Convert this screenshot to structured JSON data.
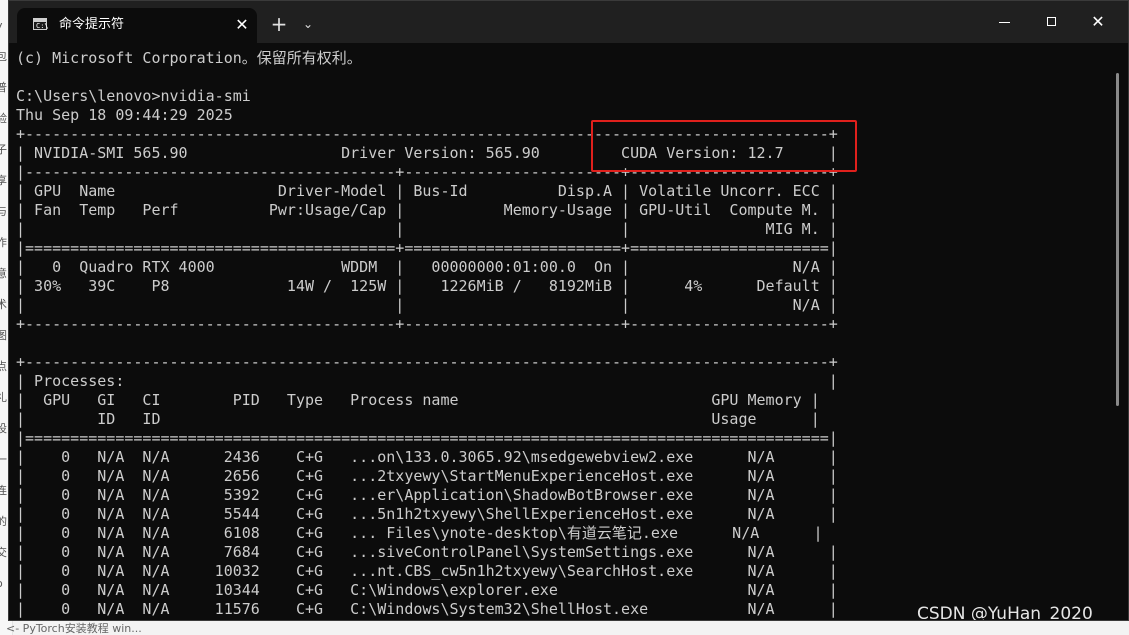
{
  "background_page": {
    "left_fragments": [
      "y",
      "包",
      "普",
      "验",
      "子",
      "享",
      "与",
      "作",
      "意",
      "术",
      "图",
      "点",
      "礼",
      "设",
      "一",
      "连",
      "的",
      "交",
      "o"
    ],
    "bottom_text": "<- PyTorch安装教程 win..."
  },
  "window": {
    "tab_title": "命令提示符",
    "tab_close": "✕",
    "new_tab": "+",
    "dropdown": "⌄",
    "close": "✕"
  },
  "terminal": {
    "lines": [
      "(c) Microsoft Corporation。保留所有权利。",
      "",
      "C:\\Users\\lenovo>nvidia-smi",
      "Thu Sep 18 09:44:29 2025",
      "+-----------------------------------------------------------------------------------------+",
      "| NVIDIA-SMI 565.90                 Driver Version: 565.90         CUDA Version: 12.7     |",
      "|-----------------------------------------+------------------------+----------------------+",
      "| GPU  Name                  Driver-Model | Bus-Id          Disp.A | Volatile Uncorr. ECC |",
      "| Fan  Temp   Perf          Pwr:Usage/Cap |           Memory-Usage | GPU-Util  Compute M. |",
      "|                                         |                        |               MIG M. |",
      "|=========================================+========================+======================|",
      "|   0  Quadro RTX 4000              WDDM  |   00000000:01:00.0  On |                  N/A |",
      "| 30%   39C    P8             14W /  125W |    1226MiB /   8192MiB |      4%      Default |",
      "|                                         |                        |                  N/A |",
      "+-----------------------------------------+------------------------+----------------------+",
      "",
      "+-----------------------------------------------------------------------------------------+",
      "| Processes:                                                                              |",
      "|  GPU   GI   CI        PID   Type   Process name                            GPU Memory |",
      "|        ID   ID                                                             Usage      |",
      "|=========================================================================================|",
      "|    0   N/A  N/A      2436    C+G   ...on\\133.0.3065.92\\msedgewebview2.exe      N/A      |",
      "|    0   N/A  N/A      2656    C+G   ...2txyewy\\StartMenuExperienceHost.exe      N/A      |",
      "|    0   N/A  N/A      5392    C+G   ...er\\Application\\ShadowBotBrowser.exe      N/A      |",
      "|    0   N/A  N/A      5544    C+G   ...5n1h2txyewy\\ShellExperienceHost.exe      N/A      |",
      "|    0   N/A  N/A      6108    C+G   ... Files\\ynote-desktop\\有道云笔记.exe      N/A      |",
      "|    0   N/A  N/A      7684    C+G   ...siveControlPanel\\SystemSettings.exe      N/A      |",
      "|    0   N/A  N/A     10032    C+G   ...nt.CBS_cw5n1h2txyewy\\SearchHost.exe      N/A      |",
      "|    0   N/A  N/A     10344    C+G   C:\\Windows\\explorer.exe                     N/A      |",
      "|    0   N/A  N/A     11576    C+G   C:\\Windows\\System32\\ShellHost.exe           N/A      |"
    ]
  },
  "watermark": "CSDN @YuHan_2020",
  "colors": {
    "terminal_bg": "#0c0c0c",
    "terminal_fg": "#cccccc",
    "titlebar_bg": "#202020",
    "highlight": "#e0201c"
  }
}
